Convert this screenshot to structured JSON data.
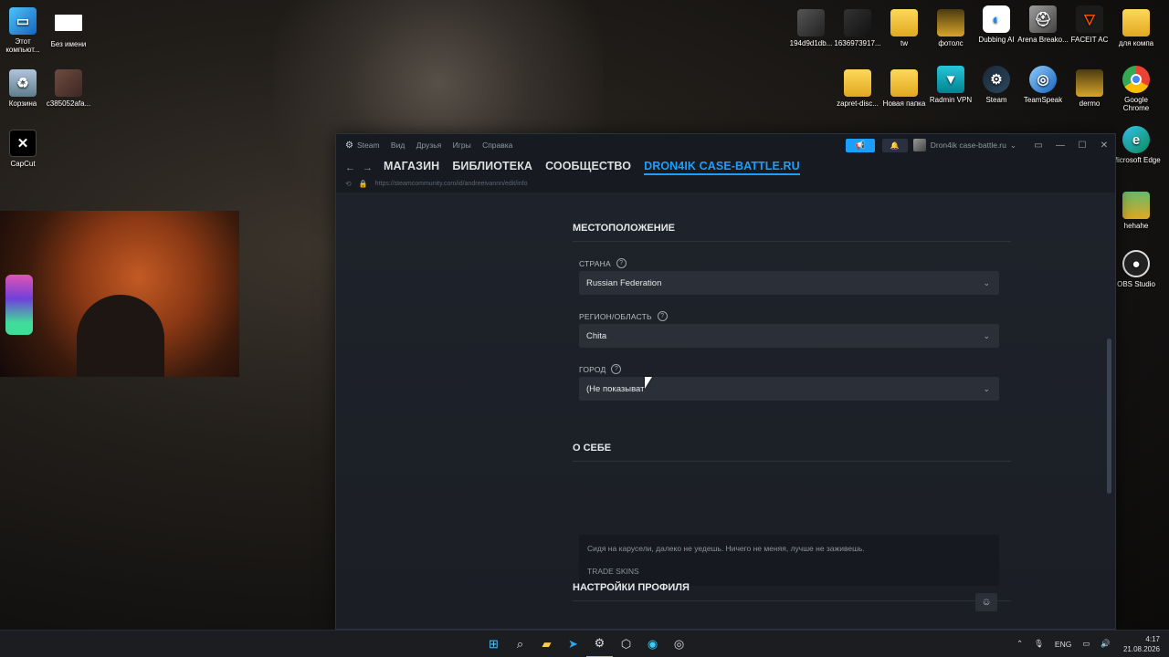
{
  "desktop": {
    "left_icons": [
      {
        "label": "Этот компьют...",
        "icon": "computer-icon"
      },
      {
        "label": "Без имени",
        "icon": "blank-file-icon"
      },
      {
        "label": "Корзина",
        "icon": "recycle-bin-icon"
      },
      {
        "label": "c385052afa...",
        "icon": "image-file-icon"
      },
      {
        "label": "CapCut",
        "icon": "capcut-icon"
      }
    ],
    "right_icons": [
      {
        "label": "194d9d1db...",
        "icon": "image-file-icon"
      },
      {
        "label": "1636973917...",
        "icon": "image-file-icon"
      },
      {
        "label": "tw",
        "icon": "folder-icon"
      },
      {
        "label": "фотолс",
        "icon": "folder-icon"
      },
      {
        "label": "Dubbing AI",
        "icon": "dubbing-ai-icon"
      },
      {
        "label": "Arena Breako...",
        "icon": "arena-breakout-icon"
      },
      {
        "label": "FACEIT AC",
        "icon": "faceit-icon"
      },
      {
        "label": "для компа",
        "icon": "folder-icon"
      },
      {
        "label": "zapret-disc...",
        "icon": "folder-icon"
      },
      {
        "label": "Новая папка",
        "icon": "folder-icon"
      },
      {
        "label": "Radmin VPN",
        "icon": "radmin-vpn-icon"
      },
      {
        "label": "Steam",
        "icon": "steam-icon"
      },
      {
        "label": "TeamSpeak",
        "icon": "teamspeak-icon"
      },
      {
        "label": "dermo",
        "icon": "folder-icon"
      },
      {
        "label": "Google Chrome",
        "icon": "chrome-icon"
      },
      {
        "label": "Microsoft Edge",
        "icon": "edge-icon"
      },
      {
        "label": "hehahe",
        "icon": "folder-icon"
      },
      {
        "label": "OBS Studio",
        "icon": "obs-icon"
      }
    ]
  },
  "steam": {
    "title_menu": {
      "app": "Steam",
      "items": [
        "Вид",
        "Друзья",
        "Игры",
        "Справка"
      ]
    },
    "username": "Dron4ik case-battle.ru",
    "tabs": [
      "МАГАЗИН",
      "БИБЛИОТЕКА",
      "СООБЩЕСТВО",
      "DRON4IK CASE-BATTLE.RU"
    ],
    "url": "https://steamcommunity.com/id/andreeivannn/edit/info",
    "location": {
      "heading": "МЕСТОПОЛОЖЕНИЕ",
      "country_label": "СТРАНА",
      "country_value": "Russian Federation",
      "region_label": "РЕГИОН/ОБЛАСТЬ",
      "region_value": "Chita",
      "city_label": "ГОРОД",
      "city_value": "(Не показыват"
    },
    "about": {
      "heading": "О СЕБЕ",
      "line1": "Сидя на карусели, далеко не уедешь. Ничего не меняя, лучше не заживешь.",
      "line2": "TRADE SKINS"
    },
    "profile_settings": {
      "heading": "НАСТРОЙКИ ПРОФИЛЯ"
    }
  },
  "taskbar": {
    "lang": "ENG",
    "time": "4:17",
    "date": "21.08.2026"
  }
}
